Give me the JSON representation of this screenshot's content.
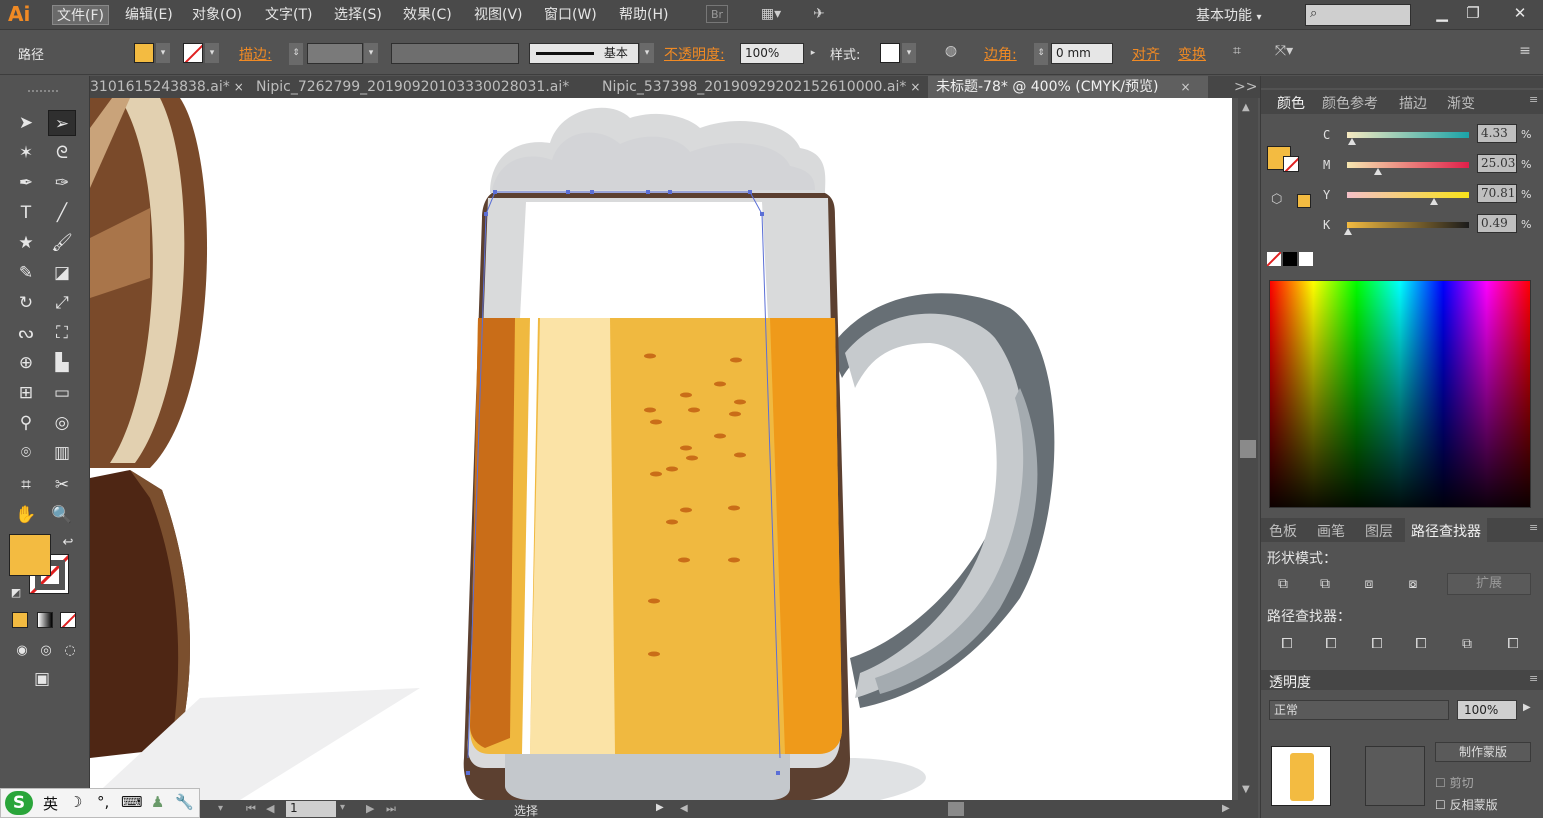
{
  "app": {
    "logo": "Ai",
    "menu": [
      "文件(F)",
      "编辑(E)",
      "对象(O)",
      "文字(T)",
      "选择(S)",
      "效果(C)",
      "视图(V)",
      "窗口(W)",
      "帮助(H)"
    ],
    "bridge_label": "Br",
    "workspace": "基本功能",
    "search_placeholder": ""
  },
  "control_bar": {
    "selection_label": "路径",
    "stroke_label": "描边",
    "stroke_colon": ":",
    "stroke_profile": "基本",
    "opacity_label": "不透明度",
    "opacity_colon": ":",
    "opacity_value": "100%",
    "style_label": "样式",
    "style_colon": ":",
    "corner_label": "边角",
    "corner_colon": ":",
    "corner_value": "0 mm",
    "align_label": "对齐",
    "transform_label": "变换",
    "fill_color": "#f3bb41"
  },
  "tabs": [
    {
      "label": "3101615243838.ai*",
      "close": "×"
    },
    {
      "label": "Nipic_7262799_20190920103330028031.ai*",
      "close": "×"
    },
    {
      "label": "Nipic_537398_20190929202152610000.ai*",
      "close": "×"
    },
    {
      "label": "未标题-78* @ 400% (CMYK/预览)",
      "close": "×"
    }
  ],
  "tab_overflow": ">>",
  "color_panel": {
    "tabs": [
      "颜色",
      "颜色参考",
      "描边",
      "渐变"
    ],
    "channels": [
      {
        "label": "C",
        "value": "4.33",
        "pct": "%",
        "level": 0.04
      },
      {
        "label": "M",
        "value": "25.03",
        "pct": "%",
        "level": 0.25
      },
      {
        "label": "Y",
        "value": "70.81",
        "pct": "%",
        "level": 0.71
      },
      {
        "label": "K",
        "value": "0.49",
        "pct": "%",
        "level": 0.005
      }
    ]
  },
  "pathfinder_panel": {
    "tabs": [
      "色板",
      "画笔",
      "图层",
      "路径查找器"
    ],
    "shape_modes_label": "形状模式：",
    "expand_label": "扩展",
    "pathfinders_label": "路径查找器："
  },
  "transparency_panel": {
    "title": "透明度",
    "mode": "正常",
    "opacity_value": "100%",
    "make_mask": "制作蒙版",
    "clip": "剪切",
    "invert_mask": "反相蒙版"
  },
  "status": {
    "zoom_page": "1",
    "tool_name": "选择"
  },
  "ime": {
    "lang": "英"
  },
  "colors": {
    "beer": "#f3bb41",
    "beer_dark": "#d07a1a",
    "beer_light": "#fbe3a6",
    "foam": "#d9dadb",
    "handle": "#9aa0a5",
    "barrel_dark": "#5a3320"
  }
}
